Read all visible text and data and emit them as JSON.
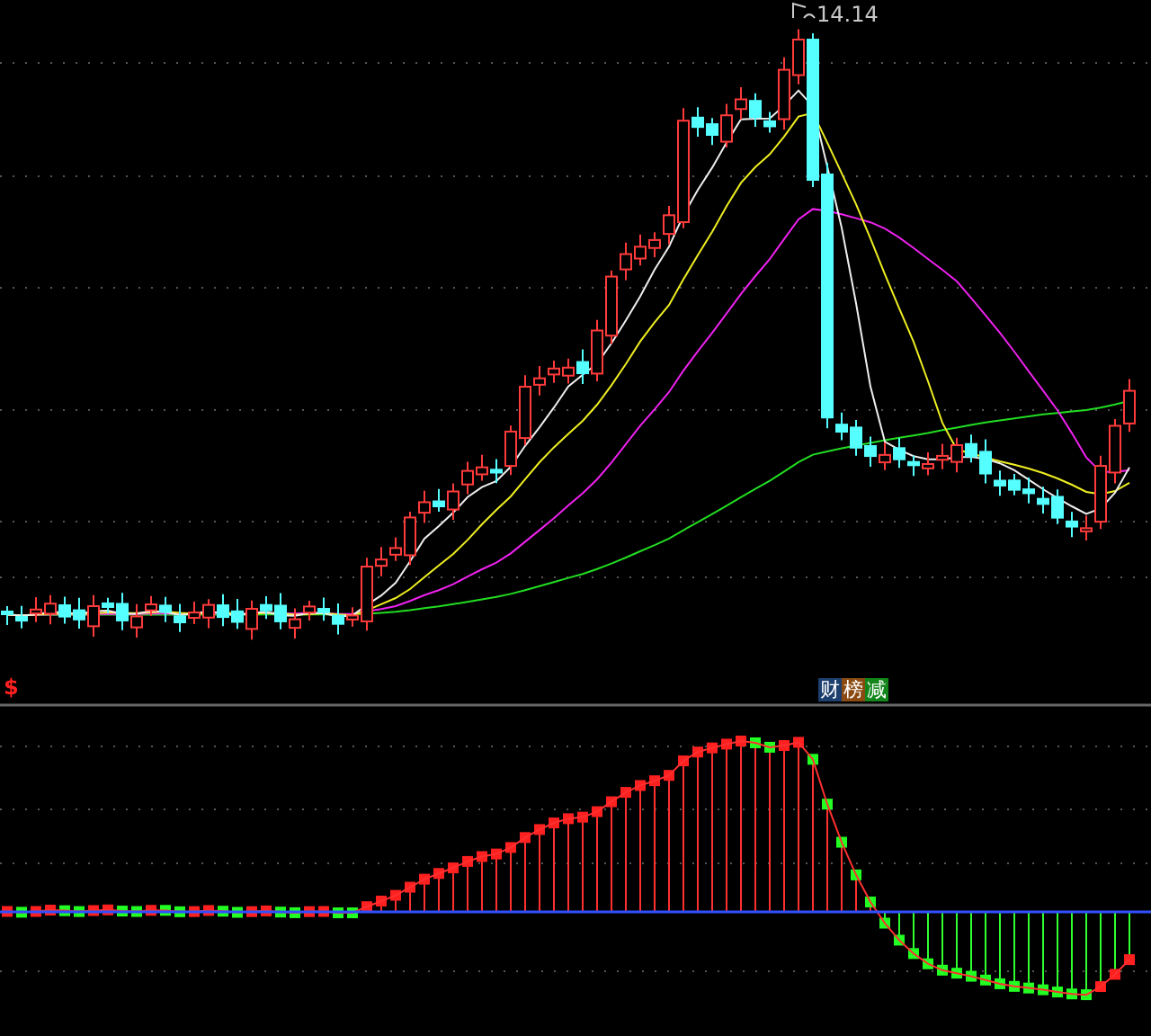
{
  "chart": {
    "high_label": "14.14",
    "signal_mark": "$"
  },
  "indicator_badges": [
    {
      "text": "财",
      "color": "#1c3f6e"
    },
    {
      "text": "榜",
      "color": "#8a4a12"
    },
    {
      "text": "减",
      "color": "#12861a"
    }
  ]
}
